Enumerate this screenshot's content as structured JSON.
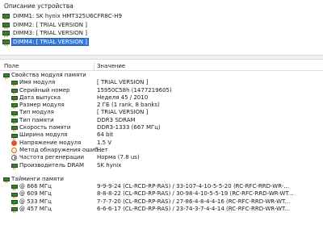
{
  "device_panel": {
    "title": "Описание устройства",
    "items": [
      {
        "label": "DIMM1: SK hynix HMT325U6CFR8C-H9"
      },
      {
        "label": "DIMM2: [ TRIAL VERSION ]"
      },
      {
        "label": "DIMM3: [ TRIAL VERSION ]"
      },
      {
        "label": "DIMM4: [ TRIAL VERSION ]"
      }
    ],
    "selected_index": 3
  },
  "columns": {
    "field": "Поле",
    "value": "Значение"
  },
  "module_props": {
    "title": "Свойства модуля памяти",
    "rows": [
      {
        "field": "Имя модуля",
        "value": "[ TRIAL VERSION ]",
        "icon": "memory-chip-icon"
      },
      {
        "field": "Серийный номер",
        "value": "15950C58h (1477219605)",
        "icon": "memory-chip-icon"
      },
      {
        "field": "Дата выпуска",
        "value": "Неделя 45 / 2010",
        "icon": "memory-chip-icon"
      },
      {
        "field": "Размер модуля",
        "value": "2 ГБ (1 rank, 8 banks)",
        "icon": "memory-chip-icon"
      },
      {
        "field": "Тип модуля",
        "value": "[ TRIAL VERSION ]",
        "icon": "memory-chip-icon"
      },
      {
        "field": "Тип памяти",
        "value": "DDR3 SDRAM",
        "icon": "memory-chip-icon"
      },
      {
        "field": "Скорость памяти",
        "value": "DDR3-1333 (667 МГц)",
        "icon": "memory-chip-icon"
      },
      {
        "field": "Ширина модуля",
        "value": "64 bit",
        "icon": "memory-chip-icon"
      },
      {
        "field": "Напряжение модуля",
        "value": "1.5 V",
        "icon": "voltage-icon"
      },
      {
        "field": "Метод обнаружения ошиб...",
        "value": "Нет",
        "icon": "error-detection-icon"
      },
      {
        "field": "Частота регенерации",
        "value": "Норма (7.8 us)",
        "icon": "refresh-clock-icon"
      },
      {
        "field": "Производитель DRAM",
        "value": "SK hynix",
        "icon": "memory-chip-icon"
      }
    ]
  },
  "timings": {
    "title": "Тайминги памяти",
    "rows": [
      {
        "field": "@ 666 МГц",
        "value": "9-9-9-24  (CL-RCD-RP-RAS) / 33-107-4-10-5-5-20  (RC-RFC-RRD-WR-..."
      },
      {
        "field": "@ 609 МГц",
        "value": "8-8-8-22  (CL-RCD-RP-RAS) / 30-98-4-10-5-5-19  (RC-RFC-RRD-WR-WT..."
      },
      {
        "field": "@ 533 МГц",
        "value": "7-7-7-20  (CL-RCD-RP-RAS) / 27-86-4-8-4-4-16  (RC-RFC-RRD-WR-WT..."
      },
      {
        "field": "@ 457 МГц",
        "value": "6-6-6-17  (CL-RCD-RP-RAS) / 23-74-3-7-4-4-14  (RC-RFC-RRD-WR-WT..."
      }
    ]
  }
}
